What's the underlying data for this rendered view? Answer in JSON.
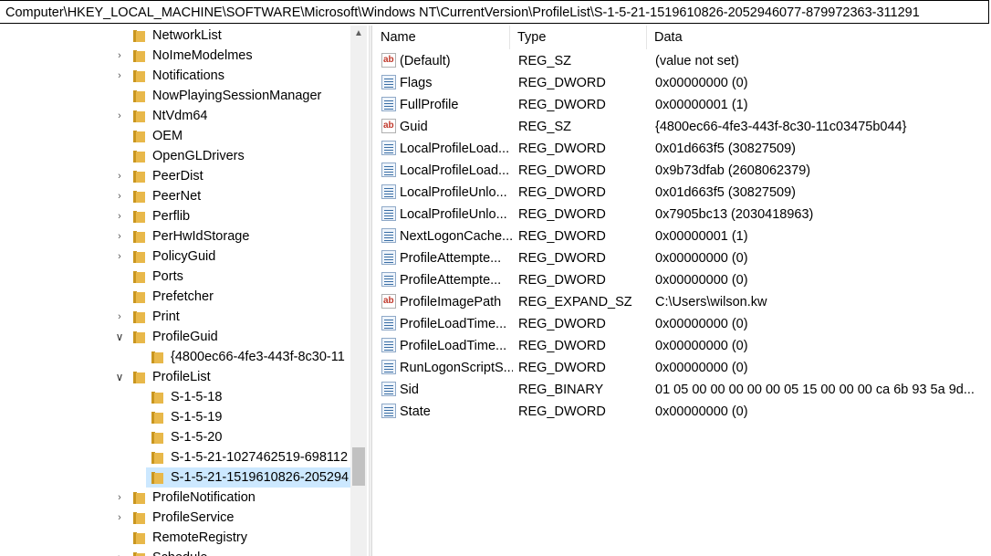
{
  "address_bar": "Computer\\HKEY_LOCAL_MACHINE\\SOFTWARE\\Microsoft\\Windows NT\\CurrentVersion\\ProfileList\\S-1-5-21-1519610826-2052946077-879972363-311291",
  "tree": [
    {
      "label": "NetworkList",
      "level": 0,
      "expander": "none"
    },
    {
      "label": "NoImeModelmes",
      "level": 0,
      "expander": "collapsed"
    },
    {
      "label": "Notifications",
      "level": 0,
      "expander": "collapsed"
    },
    {
      "label": "NowPlayingSessionManager",
      "level": 0,
      "expander": "none"
    },
    {
      "label": "NtVdm64",
      "level": 0,
      "expander": "collapsed"
    },
    {
      "label": "OEM",
      "level": 0,
      "expander": "none"
    },
    {
      "label": "OpenGLDrivers",
      "level": 0,
      "expander": "none"
    },
    {
      "label": "PeerDist",
      "level": 0,
      "expander": "collapsed"
    },
    {
      "label": "PeerNet",
      "level": 0,
      "expander": "collapsed"
    },
    {
      "label": "Perflib",
      "level": 0,
      "expander": "collapsed"
    },
    {
      "label": "PerHwIdStorage",
      "level": 0,
      "expander": "collapsed"
    },
    {
      "label": "PolicyGuid",
      "level": 0,
      "expander": "collapsed"
    },
    {
      "label": "Ports",
      "level": 0,
      "expander": "none"
    },
    {
      "label": "Prefetcher",
      "level": 0,
      "expander": "none"
    },
    {
      "label": "Print",
      "level": 0,
      "expander": "collapsed"
    },
    {
      "label": "ProfileGuid",
      "level": 0,
      "expander": "expanded"
    },
    {
      "label": "{4800ec66-4fe3-443f-8c30-11",
      "level": 1,
      "expander": "none"
    },
    {
      "label": "ProfileList",
      "level": 0,
      "expander": "expanded"
    },
    {
      "label": "S-1-5-18",
      "level": 1,
      "expander": "none"
    },
    {
      "label": "S-1-5-19",
      "level": 1,
      "expander": "none"
    },
    {
      "label": "S-1-5-20",
      "level": 1,
      "expander": "none"
    },
    {
      "label": "S-1-5-21-1027462519-698112",
      "level": 1,
      "expander": "none"
    },
    {
      "label": "S-1-5-21-1519610826-205294",
      "level": 1,
      "expander": "none",
      "selected": true
    },
    {
      "label": "ProfileNotification",
      "level": 0,
      "expander": "collapsed"
    },
    {
      "label": "ProfileService",
      "level": 0,
      "expander": "collapsed"
    },
    {
      "label": "RemoteRegistry",
      "level": 0,
      "expander": "none"
    },
    {
      "label": "Schedule",
      "level": 0,
      "expander": "collapsed"
    }
  ],
  "columns": {
    "name": "Name",
    "type": "Type",
    "data": "Data"
  },
  "values": [
    {
      "icon": "string-value-icon",
      "name": "(Default)",
      "type": "REG_SZ",
      "data": "(value not set)"
    },
    {
      "icon": "binary-value-icon",
      "name": "Flags",
      "type": "REG_DWORD",
      "data": "0x00000000 (0)"
    },
    {
      "icon": "binary-value-icon",
      "name": "FullProfile",
      "type": "REG_DWORD",
      "data": "0x00000001 (1)"
    },
    {
      "icon": "string-value-icon",
      "name": "Guid",
      "type": "REG_SZ",
      "data": "{4800ec66-4fe3-443f-8c30-11c03475b044}"
    },
    {
      "icon": "binary-value-icon",
      "name": "LocalProfileLoad...",
      "type": "REG_DWORD",
      "data": "0x01d663f5 (30827509)"
    },
    {
      "icon": "binary-value-icon",
      "name": "LocalProfileLoad...",
      "type": "REG_DWORD",
      "data": "0x9b73dfab (2608062379)"
    },
    {
      "icon": "binary-value-icon",
      "name": "LocalProfileUnlo...",
      "type": "REG_DWORD",
      "data": "0x01d663f5 (30827509)"
    },
    {
      "icon": "binary-value-icon",
      "name": "LocalProfileUnlo...",
      "type": "REG_DWORD",
      "data": "0x7905bc13 (2030418963)"
    },
    {
      "icon": "binary-value-icon",
      "name": "NextLogonCache...",
      "type": "REG_DWORD",
      "data": "0x00000001 (1)"
    },
    {
      "icon": "binary-value-icon",
      "name": "ProfileAttempte...",
      "type": "REG_DWORD",
      "data": "0x00000000 (0)"
    },
    {
      "icon": "binary-value-icon",
      "name": "ProfileAttempte...",
      "type": "REG_DWORD",
      "data": "0x00000000 (0)"
    },
    {
      "icon": "string-value-icon",
      "name": "ProfileImagePath",
      "type": "REG_EXPAND_SZ",
      "data": "C:\\Users\\wilson.kw"
    },
    {
      "icon": "binary-value-icon",
      "name": "ProfileLoadTime...",
      "type": "REG_DWORD",
      "data": "0x00000000 (0)"
    },
    {
      "icon": "binary-value-icon",
      "name": "ProfileLoadTime...",
      "type": "REG_DWORD",
      "data": "0x00000000 (0)"
    },
    {
      "icon": "binary-value-icon",
      "name": "RunLogonScriptS...",
      "type": "REG_DWORD",
      "data": "0x00000000 (0)"
    },
    {
      "icon": "binary-value-icon",
      "name": "Sid",
      "type": "REG_BINARY",
      "data": "01 05 00 00 00 00 00 05 15 00 00 00 ca 6b 93 5a 9d..."
    },
    {
      "icon": "binary-value-icon",
      "name": "State",
      "type": "REG_DWORD",
      "data": "0x00000000 (0)"
    }
  ],
  "colors": {
    "selection": "#cce8ff",
    "folder": "#e8b84a",
    "scrollbar_track": "#f0f0f0"
  }
}
